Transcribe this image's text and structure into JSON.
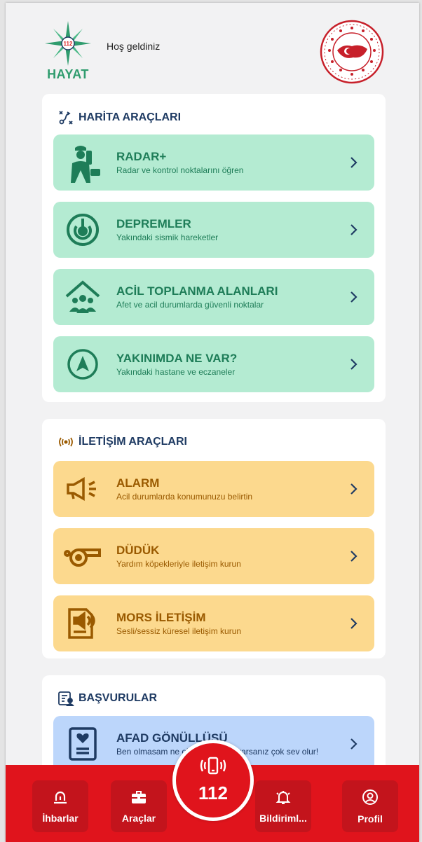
{
  "header": {
    "logo_text": "HAYAT",
    "logo_badge": "112",
    "welcome": "Hoş geldiniz"
  },
  "map_tools": {
    "title": "HARİTA ARAÇLARI",
    "items": [
      {
        "title": "RADAR+",
        "subtitle": "Radar ve kontrol noktalarını öğren",
        "icon": "police-radar-icon"
      },
      {
        "title": "DEPREMLER",
        "subtitle": "Yakındaki sismik hareketler",
        "icon": "seismic-icon"
      },
      {
        "title": "ACİL TOPLANMA ALANLARI",
        "subtitle": "Afet ve acil durumlarda güvenli noktalar",
        "icon": "gathering-area-icon"
      },
      {
        "title": "YAKINIMDA NE VAR?",
        "subtitle": "Yakındaki hastane ve eczaneler",
        "icon": "navigation-icon"
      }
    ]
  },
  "comm_tools": {
    "title": "İLETİŞİM ARAÇLARI",
    "items": [
      {
        "title": "ALARM",
        "subtitle": "Acil durumlarda konumunuzu belirtin",
        "icon": "megaphone-icon"
      },
      {
        "title": "DÜDÜK",
        "subtitle": "Yardım köpekleriyle iletişim kurun",
        "icon": "whistle-icon"
      },
      {
        "title": "MORS İLETİŞİM",
        "subtitle": "Sesli/sessiz küresel iletişim kurun",
        "icon": "morse-icon"
      }
    ]
  },
  "applications": {
    "title": "BAŞVURULAR",
    "items": [
      {
        "title": "AFAD GÖNÜLLÜSÜ",
        "subtitle": "Ben olmasam ne olur demeyin... Siz varsanız çok sey olur!",
        "subtitle_visible": "Ben olmasam ne ol        in... Siz varsanız çok sev olur!",
        "icon": "volunteer-icon"
      }
    ]
  },
  "bottom_nav": {
    "items": [
      {
        "label": "İhbarlar",
        "icon": "report-icon"
      },
      {
        "label": "Araçlar",
        "icon": "toolbox-icon"
      },
      {
        "label": "Bildiriml...",
        "icon": "bell-icon"
      },
      {
        "label": "Profil",
        "icon": "profile-icon"
      }
    ],
    "center": {
      "label": "112",
      "icon": "phone-vibrate-icon"
    }
  },
  "colors": {
    "green_card": "#b4ebd2",
    "green_text": "#1e7d58",
    "orange_card": "#fcd98e",
    "orange_text": "#9a5a00",
    "blue_card": "#bcd6fb",
    "navy": "#1f3b63",
    "red_bar": "#e0141c"
  }
}
